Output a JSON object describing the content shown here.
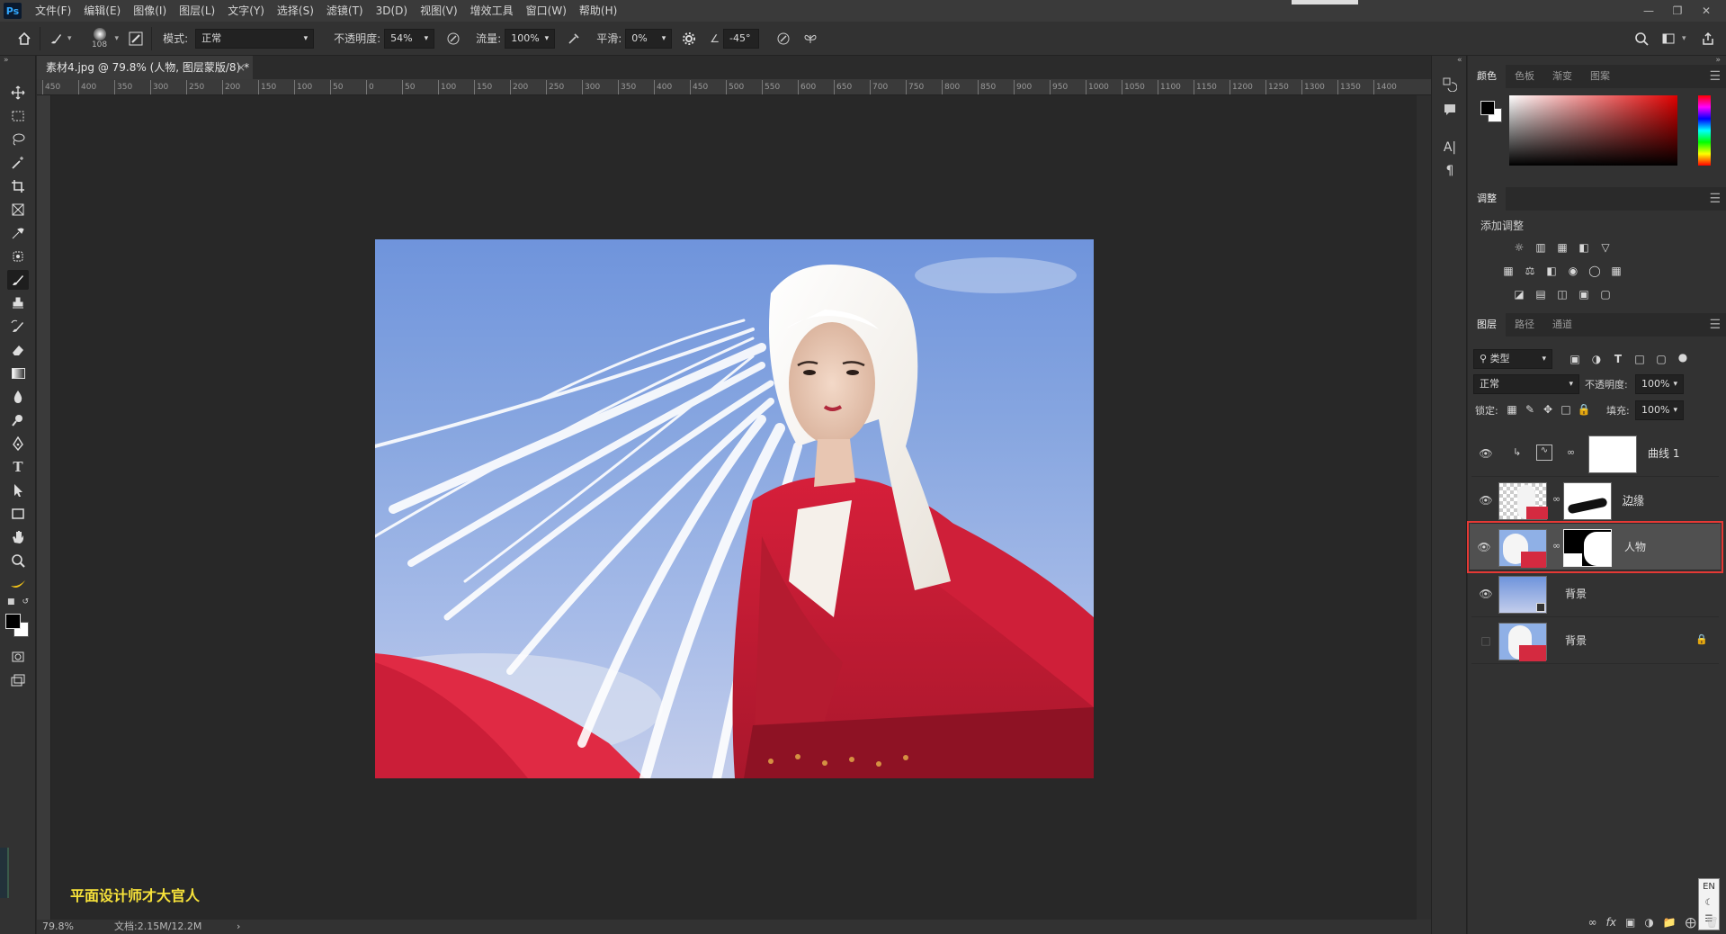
{
  "app": {
    "logo": "Ps"
  },
  "menu": [
    "文件(F)",
    "编辑(E)",
    "图像(I)",
    "图层(L)",
    "文字(Y)",
    "选择(S)",
    "滤镜(T)",
    "3D(D)",
    "视图(V)",
    "增效工具",
    "窗口(W)",
    "帮助(H)"
  ],
  "options": {
    "brush_size": "108",
    "mode_label": "模式:",
    "mode_value": "正常",
    "opacity_label": "不透明度:",
    "opacity_value": "54%",
    "flow_label": "流量:",
    "flow_value": "100%",
    "smooth_label": "平滑:",
    "smooth_value": "0%",
    "angle_value": "-45°"
  },
  "document": {
    "tab_title": "素材4.jpg @ 79.8% (人物, 图层蒙版/8) *",
    "close_glyph": "×",
    "zoom": "79.8%",
    "doc_info": "文档:2.15M/12.2M",
    "status_arrow": "›"
  },
  "ruler_top": [
    "450",
    "400",
    "350",
    "300",
    "250",
    "200",
    "150",
    "100",
    "50",
    "0",
    "50",
    "100",
    "150",
    "200",
    "250",
    "300",
    "350",
    "400",
    "450",
    "500",
    "550",
    "600",
    "650",
    "700",
    "750",
    "800",
    "850",
    "900",
    "950",
    "1000",
    "1050",
    "1100",
    "1150",
    "1200",
    "1250",
    "1300",
    "1350",
    "1400"
  ],
  "watermark": "平面设计师才大官人",
  "panels": {
    "color_tabs": [
      "颜色",
      "色板",
      "渐变",
      "图案"
    ],
    "adjust_tab": "调整",
    "adjust_title": "添加调整",
    "layers_tabs": [
      "图层",
      "路径",
      "通道"
    ],
    "filter_type": "类型",
    "blend_mode": "正常",
    "opacity_label": "不透明度:",
    "opacity_value": "100%",
    "lock_label": "锁定:",
    "fill_label": "填充:",
    "fill_value": "100%",
    "layers": [
      {
        "name": "曲线 1"
      },
      {
        "name": "边缘"
      },
      {
        "name": "人物"
      },
      {
        "name": "背景"
      },
      {
        "name": "背景"
      }
    ],
    "ime_label": "EN"
  },
  "colors": {
    "selection_outline": "#e53935",
    "watermark": "#f7e23a"
  }
}
